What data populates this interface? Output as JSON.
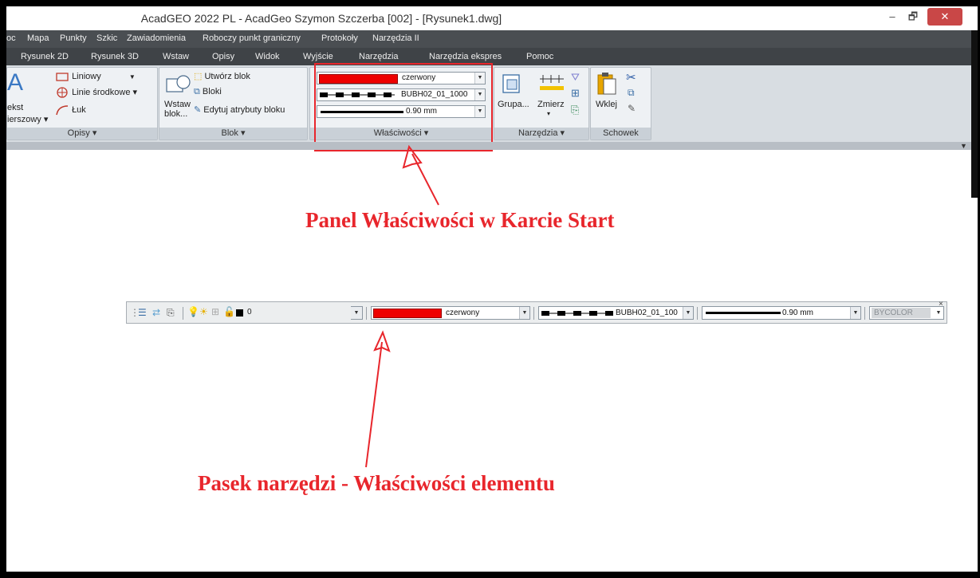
{
  "window": {
    "title": "AcadGEO 2022 PL - AcadGeo Szymon Szczerba [002] - [Rysunek1.dwg]",
    "minimize": "–",
    "maximize": "🗗",
    "close": "✕"
  },
  "menu": [
    "oc",
    "Mapa",
    "Punkty",
    "Szkic",
    "Zawiadomienia",
    "Roboczy punkt graniczny",
    "Protokoły",
    "Narzędzia II"
  ],
  "tabs": [
    "Rysunek 2D",
    "Rysunek 3D",
    "Wstaw",
    "Opisy",
    "Widok",
    "Wyjście",
    "Narzędzia",
    "Narzędzia ekspres",
    "Pomoc"
  ],
  "ribbon": {
    "opisy": {
      "title": "Opisy ▾",
      "tekst_line1": "ekst",
      "tekst_line2": "ierszowy ▾",
      "liniowy": "Liniowy",
      "linie": "Linie środkowe ▾",
      "luk": "Łuk"
    },
    "blok": {
      "title": "Blok ▾",
      "wstaw_line1": "Wstaw",
      "wstaw_line2": "blok...",
      "utworz": "Utwórz blok",
      "bloki": "Bloki",
      "edytuj": "Edytuj atrybuty bloku"
    },
    "wlasciwosci": {
      "title": "Właściwości ▾",
      "color": "czerwony",
      "linetype": "BUBH02_01_1000",
      "lineweight": "0.90 mm",
      "color_hex": "#ee0000"
    },
    "narzedzia": {
      "title": "Narzędzia ▾",
      "grupa": "Grupa...",
      "zmierz": "Zmierz",
      "zmierz_arrow": "▾"
    },
    "schowek": {
      "title": "Schowek",
      "wklej": "Wklej"
    }
  },
  "annotations": {
    "top": "Panel Właściwości w Karcie Start",
    "bottom": "Pasek narzędzi - Właściwości elementu",
    "color": "#e8262c"
  },
  "toolbar": {
    "layer": "0",
    "color": "czerwony",
    "linetype": "BUBH02_01_100",
    "lineweight": "0.90 mm",
    "plotstyle": "BYCOLOR",
    "close": "×"
  }
}
